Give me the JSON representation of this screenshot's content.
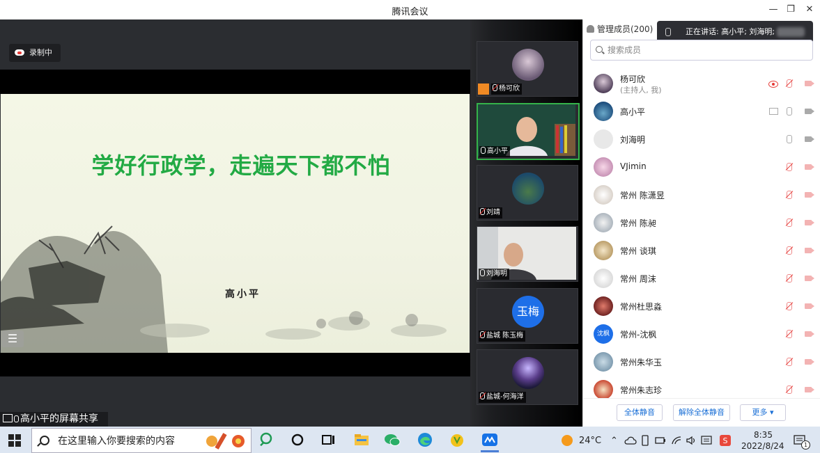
{
  "window": {
    "title": "腾讯会议",
    "controls": [
      "—",
      "❐",
      "✕"
    ]
  },
  "stage": {
    "recording_label": "录制中",
    "slide_title": "学好行政学，走遍天下都不怕",
    "slide_author": "高小平",
    "share_label": "高小平的屏幕共享",
    "menu_glyph": "☰"
  },
  "tiles": [
    {
      "name": "杨可欣",
      "mic": "muted"
    },
    {
      "name": "高小平",
      "mic": "on"
    },
    {
      "name": "刘靖",
      "mic": "muted"
    },
    {
      "name": "刘海明",
      "mic": "on"
    },
    {
      "name": "盐城 陈玉梅",
      "mic": "muted",
      "avatar_text": "玉梅"
    },
    {
      "name": "盐城-何海洋",
      "mic": "muted"
    }
  ],
  "panel": {
    "tab_label": "管理成员(200)",
    "speaking": "正在讲话: 高小平; 刘海明;",
    "search_placeholder": "搜索成员",
    "members": [
      {
        "name": "杨可欣",
        "sub": "(主持人, 我)",
        "mic": "muted",
        "cam": "off",
        "extra": "recording"
      },
      {
        "name": "高小平",
        "mic": "on",
        "cam": "on",
        "extra": "sharing"
      },
      {
        "name": "刘海明",
        "mic": "on",
        "cam": "on"
      },
      {
        "name": "VJimin",
        "mic": "muted",
        "cam": "off"
      },
      {
        "name": "常州   陈潇昱",
        "mic": "muted",
        "cam": "off"
      },
      {
        "name": "常州 陈昶",
        "mic": "muted",
        "cam": "off"
      },
      {
        "name": "常州 谈琪",
        "mic": "muted",
        "cam": "off"
      },
      {
        "name": "常州 周沫",
        "mic": "muted",
        "cam": "off"
      },
      {
        "name": "常州杜思淼",
        "mic": "muted",
        "cam": "off"
      },
      {
        "name": "常州-沈枫",
        "mic": "muted",
        "cam": "off",
        "avatar_text": "沈枫"
      },
      {
        "name": "常州朱华玉",
        "mic": "muted",
        "cam": "off"
      },
      {
        "name": "常州朱志珍",
        "mic": "muted",
        "cam": "off"
      }
    ],
    "buttons": {
      "mute_all": "全体静音",
      "unmute_all": "解除全体静音",
      "more": "更多 ▾"
    }
  },
  "taskbar": {
    "search_placeholder": "在这里输入你要搜索的内容",
    "temperature": "24°C",
    "time": "8:35",
    "date": "2022/8/24",
    "notification_count": "1"
  },
  "colors": {
    "accent_green": "#22aa44",
    "link_blue": "#1a6fd6",
    "mute_red": "#e53935"
  }
}
